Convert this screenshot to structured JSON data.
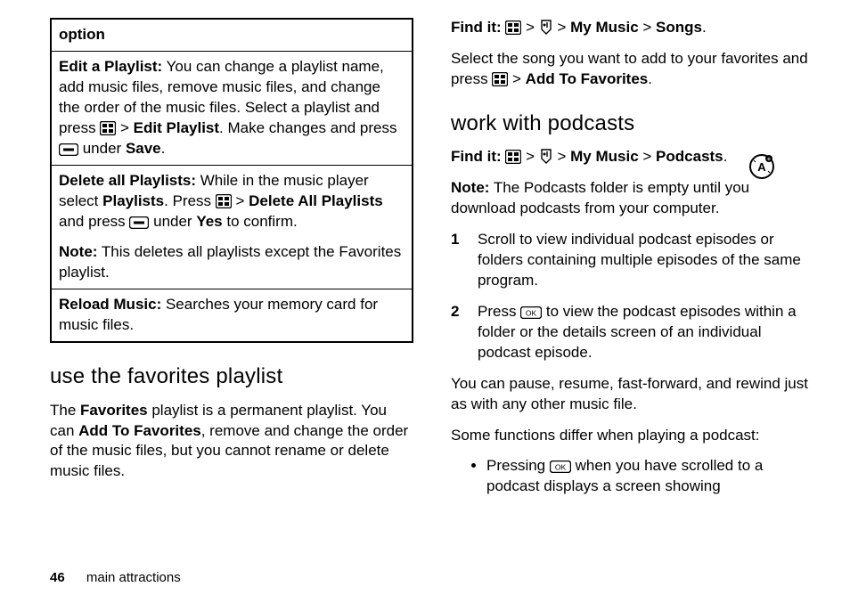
{
  "table": {
    "header": "option",
    "rows": [
      {
        "lead": "Edit a Playlist:",
        "t1": " You can change a playlist name, add music files, remove music files, and change the order of the music files. Select a playlist and press ",
        "t2": " > ",
        "action1": "Edit Playlist",
        "t3": ". Make changes and press ",
        "t4": " under ",
        "action2": "Save",
        "t5": "."
      },
      {
        "lead": "Delete all Playlists:",
        "t1": " While in the music player select ",
        "action1": "Playlists",
        "t2": ". Press ",
        "t3": " > ",
        "action2": "Delete All Playlists",
        "t4": " and press ",
        "t5": " under ",
        "action3": "Yes",
        "t6": " to confirm.",
        "noteLead": "Note:",
        "noteText": " This deletes all playlists except the Favorites playlist."
      },
      {
        "lead": "Reload Music:",
        "t1": " Searches your memory card for music files."
      }
    ]
  },
  "left": {
    "h2": "use the favorites playlist",
    "p1a": "The ",
    "p1b": "Favorites",
    "p1c": " playlist is a permanent playlist. You can ",
    "p1d": "Add To Favorites",
    "p1e": ", remove and change the order of the music files, but you cannot rename or delete music files."
  },
  "right": {
    "find1": {
      "label": "Find it:",
      "sep": " > ",
      "a": "My Music",
      "b": "Songs",
      "end": "."
    },
    "p1a": "Select the song you want to add to your favorites and press ",
    "p1b": " > ",
    "p1c": "Add To Favorites",
    "p1d": ".",
    "h2": "work with podcasts",
    "find2": {
      "label": "Find it:",
      "sep": " > ",
      "a": "My Music",
      "b": "Podcasts",
      "end": "."
    },
    "noteLead": "Note:",
    "noteText": " The Podcasts folder is empty until you download podcasts from your computer.",
    "li1": "Scroll to view individual podcast episodes or folders containing multiple episodes of the same program.",
    "li2a": "Press ",
    "li2b": " to view the podcast episodes within a folder or the details screen of an individual podcast episode.",
    "p2": "You can pause, resume, fast-forward, and rewind just as with any other music file.",
    "p3": "Some functions differ when playing a podcast:",
    "b1a": "Pressing ",
    "b1b": " when you have scrolled to a podcast displays a screen showing"
  },
  "footer": {
    "page": "46",
    "section": "main attractions"
  }
}
